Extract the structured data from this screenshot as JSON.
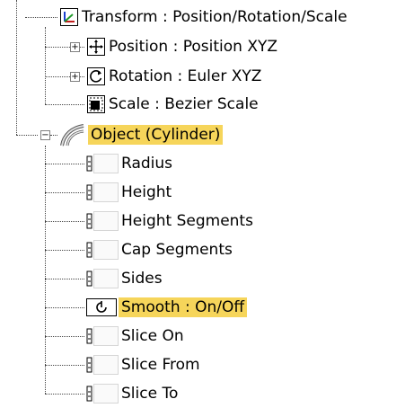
{
  "tree": {
    "transform": {
      "label": "Transform : Position/Rotation/Scale",
      "icon": "transform-axis-icon"
    },
    "position": {
      "label": "Position : Position XYZ",
      "icon": "position-move-icon"
    },
    "rotation": {
      "label": "Rotation : Euler XYZ",
      "icon": "rotation-icon"
    },
    "scale": {
      "label": "Scale : Bezier Scale",
      "icon": "scale-icon"
    },
    "object": {
      "label": "Object (Cylinder)",
      "icon": "cylinder-object-icon"
    },
    "params": [
      {
        "label": "Radius"
      },
      {
        "label": "Height"
      },
      {
        "label": "Height Segments"
      },
      {
        "label": "Cap Segments"
      },
      {
        "label": "Sides"
      },
      {
        "label": "Smooth : On/Off"
      },
      {
        "label": "Slice On"
      },
      {
        "label": "Slice From"
      },
      {
        "label": "Slice To"
      }
    ],
    "expanders": {
      "collapsed": "+",
      "expanded": "−"
    },
    "colors": {
      "highlight": "#f6d55a",
      "dotted_line": "#444444"
    }
  }
}
